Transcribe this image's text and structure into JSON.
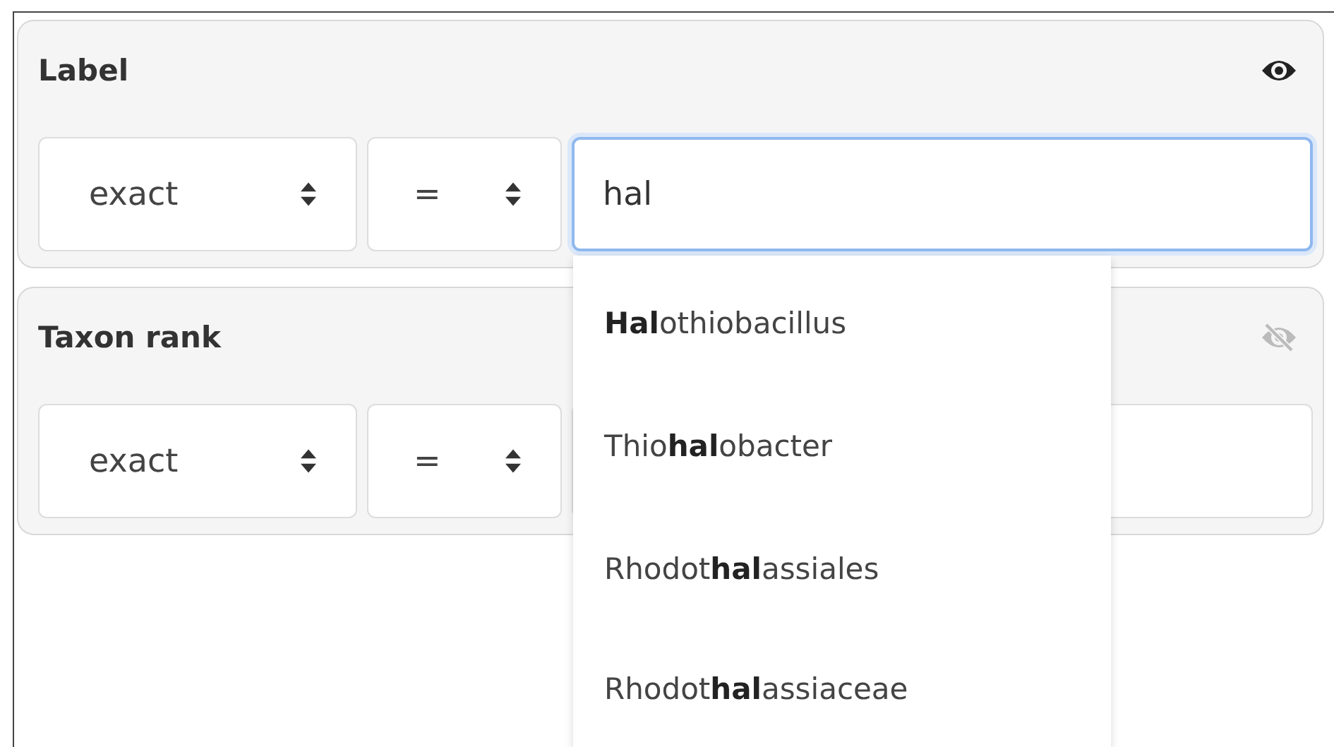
{
  "filters": [
    {
      "title": "Label",
      "visible": true,
      "mode": "exact",
      "operator": "=",
      "value": "hal",
      "focused": true,
      "suggestions": [
        "**Hal**othiobacillus",
        "Thio**hal**obacter",
        "Rhodot**hal**assiales",
        "Rhodot**hal**assiaceae"
      ]
    },
    {
      "title": "Taxon rank",
      "visible": false,
      "mode": "exact",
      "operator": "=",
      "focused": false
    }
  ]
}
